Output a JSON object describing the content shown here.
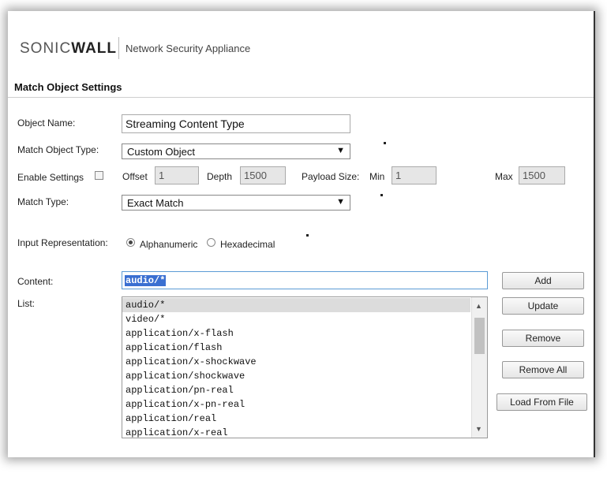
{
  "header": {
    "brand_sonic": "SONIC",
    "brand_wall": "WALL",
    "product": "Network Security Appliance"
  },
  "section": {
    "title": "Match Object Settings"
  },
  "form": {
    "object_name": {
      "label": "Object Name:",
      "value": "Streaming Content Type"
    },
    "match_object_type": {
      "label": "Match Object Type:",
      "value": "Custom Object"
    },
    "enable_settings": {
      "label": "Enable Settings",
      "checked": false,
      "offset_label": "Offset",
      "offset_value": "1",
      "depth_label": "Depth",
      "depth_value": "1500",
      "payload_label": "Payload Size:",
      "min_label": "Min",
      "min_value": "1",
      "max_label": "Max",
      "max_value": "1500"
    },
    "match_type": {
      "label": "Match Type:",
      "value": "Exact Match"
    },
    "input_representation": {
      "label": "Input Representation:",
      "options": [
        "Alphanumeric",
        "Hexadecimal"
      ],
      "selected": "Alphanumeric"
    },
    "content": {
      "label": "Content:",
      "value": "audio/*"
    },
    "list": {
      "label": "List:",
      "items": [
        "audio/*",
        "video/*",
        "application/x-flash",
        "application/flash",
        "application/x-shockwave",
        "application/shockwave",
        "application/pn-real",
        "application/x-pn-real",
        "application/real",
        "application/x-real"
      ],
      "selected_index": 0
    }
  },
  "buttons": {
    "add": "Add",
    "update": "Update",
    "remove": "Remove",
    "remove_all": "Remove All",
    "load_from_file": "Load From File"
  },
  "icons": {
    "dropdown_arrow": "▼",
    "scroll_up": "▲",
    "scroll_down": "▼"
  }
}
